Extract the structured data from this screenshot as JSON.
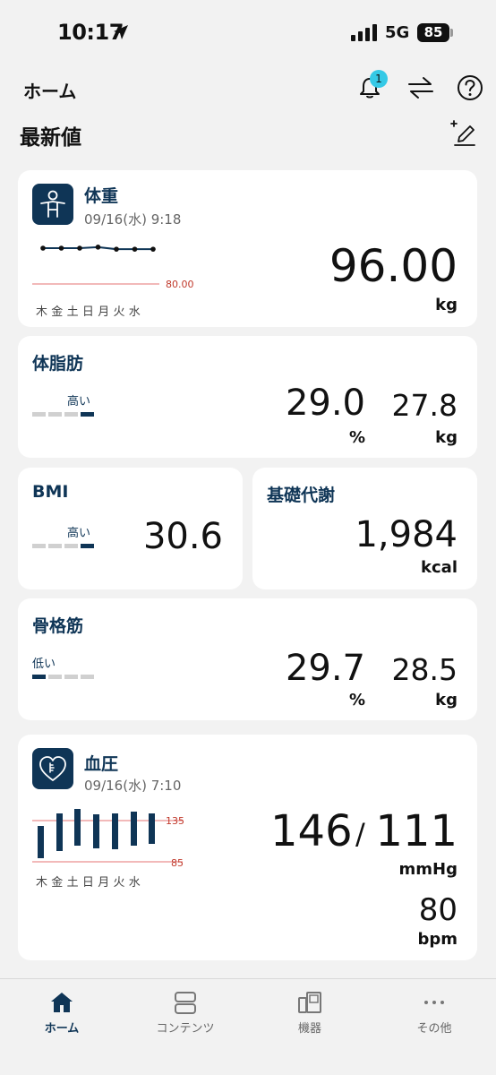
{
  "status_bar": {
    "time": "10:17",
    "network": "5G",
    "battery": "85"
  },
  "header": {
    "title": "ホーム",
    "notification_count": "1"
  },
  "section_title": "最新値",
  "weight": {
    "title": "体重",
    "date": "09/16(水) 9:18",
    "value": "96.00",
    "unit": "kg",
    "ref_value": "80.00",
    "days": "木金土日月火水",
    "trend": [
      96.1,
      96.1,
      96.1,
      96.2,
      96.0,
      96.0,
      96.0
    ]
  },
  "body_fat": {
    "title": "体脂肪",
    "level": "高い",
    "percent": "29.0",
    "percent_unit": "%",
    "mass": "27.8",
    "mass_unit": "kg"
  },
  "bmi": {
    "title": "BMI",
    "level": "高い",
    "value": "30.6"
  },
  "bmr": {
    "title": "基礎代謝",
    "value": "1,984",
    "unit": "kcal"
  },
  "muscle": {
    "title": "骨格筋",
    "level": "低い",
    "percent": "29.7",
    "percent_unit": "%",
    "mass": "28.5",
    "mass_unit": "kg"
  },
  "blood_pressure": {
    "title": "血圧",
    "date": "09/16(水) 7:10",
    "systolic": "146",
    "separator": "/",
    "diastolic": "111",
    "unit": "mmHg",
    "pulse": "80",
    "pulse_unit": "bpm",
    "ref_high": "135",
    "ref_low": "85",
    "days": "木金土日月火水"
  },
  "nav": {
    "home": "ホーム",
    "contents": "コンテンツ",
    "devices": "機器",
    "other": "その他"
  },
  "colors": {
    "accent": "#0f3556",
    "reference": "#c0392b",
    "badge": "#35c9e6"
  }
}
